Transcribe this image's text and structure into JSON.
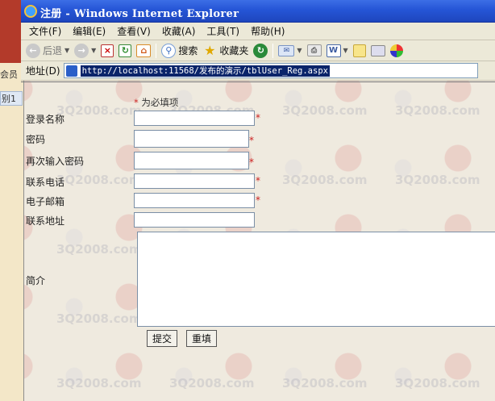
{
  "window": {
    "title": "注册 - Windows Internet Explorer"
  },
  "menu": [
    "文件(F)",
    "编辑(E)",
    "查看(V)",
    "收藏(A)",
    "工具(T)",
    "帮助(H)"
  ],
  "toolbar": {
    "back_label": "后退",
    "search_label": "搜索",
    "favorites_label": "收藏夹"
  },
  "address": {
    "label": "地址(D)",
    "url": "http://localhost:11568/发布的演示/tblUser_Reg.aspx"
  },
  "background_window": {
    "text1": "会员",
    "text2": "别1"
  },
  "form": {
    "required_note": "为必填项",
    "required_mark": "*",
    "fields": [
      {
        "label": "登录名称",
        "required": true
      },
      {
        "label": "密码",
        "required": true
      },
      {
        "label": "再次输入密码",
        "required": true
      },
      {
        "label": "联系电话",
        "required": true
      },
      {
        "label": "电子邮箱",
        "required": true
      },
      {
        "label": "联系地址",
        "required": false
      }
    ],
    "intro_label": "简介",
    "submit_label": "提交",
    "reset_label": "重填"
  },
  "watermark": {
    "text": "3Q2008.com"
  },
  "colors": {
    "titlebar": "#2555d6",
    "required": "#cc1f1f",
    "url_highlight": "#0a246a"
  }
}
